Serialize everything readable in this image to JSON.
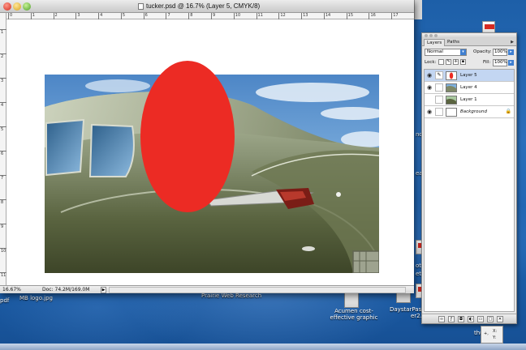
{
  "window": {
    "title": "tucker.psd @ 16.7% (Layer 5, CMYK/8)",
    "zoom": "16.67%",
    "doc_size": "Doc: 74.2M/169.0M",
    "status_arrow": "▶"
  },
  "ruler": {
    "h_ticks": [
      "0",
      "1",
      "2",
      "3",
      "4",
      "5",
      "6",
      "7",
      "8",
      "9",
      "10",
      "11",
      "12",
      "13",
      "14",
      "15",
      "16",
      "17"
    ],
    "v_ticks": [
      "1",
      "2",
      "3",
      "4",
      "5",
      "6",
      "7",
      "8",
      "9",
      "10",
      "11"
    ]
  },
  "layers_panel": {
    "tabs": [
      "Layers",
      "Paths"
    ],
    "active_tab": "Layers",
    "blend_mode": "Normal",
    "opacity_label": "Opacity:",
    "opacity_value": "100%",
    "lock_label": "Lock:",
    "fill_label": "Fill:",
    "fill_value": "100%",
    "layers": [
      {
        "name": "Layer 5",
        "visible": true,
        "selected": true
      },
      {
        "name": "Layer 4",
        "visible": true,
        "selected": false
      },
      {
        "name": "Layer 1",
        "visible": false,
        "selected": false
      },
      {
        "name": "Background",
        "visible": true,
        "selected": false,
        "locked": true
      }
    ]
  },
  "desktop": {
    "labels": {
      "pdf_left": "pdf",
      "logo_file": "MB logo.jpg",
      "prairie": "Prairie Web Research",
      "acumen_line1": "Acumen cost-",
      "acumen_line2": "effective graphic",
      "daystar_line1": "DaystarPass",
      "daystar_line2": "er2.p",
      "thu": "thu",
      "side_a": "no",
      "side_b": "ea",
      "side_c": "ot",
      "side_d": "et"
    }
  },
  "info_chip": {
    "label_x": "X:",
    "label_y": "Y:",
    "plus": "+,"
  },
  "colors": {
    "ellipse": "#ec2b24",
    "desktop": "#1e63b0",
    "selected_layer": "#c3d6f2"
  }
}
